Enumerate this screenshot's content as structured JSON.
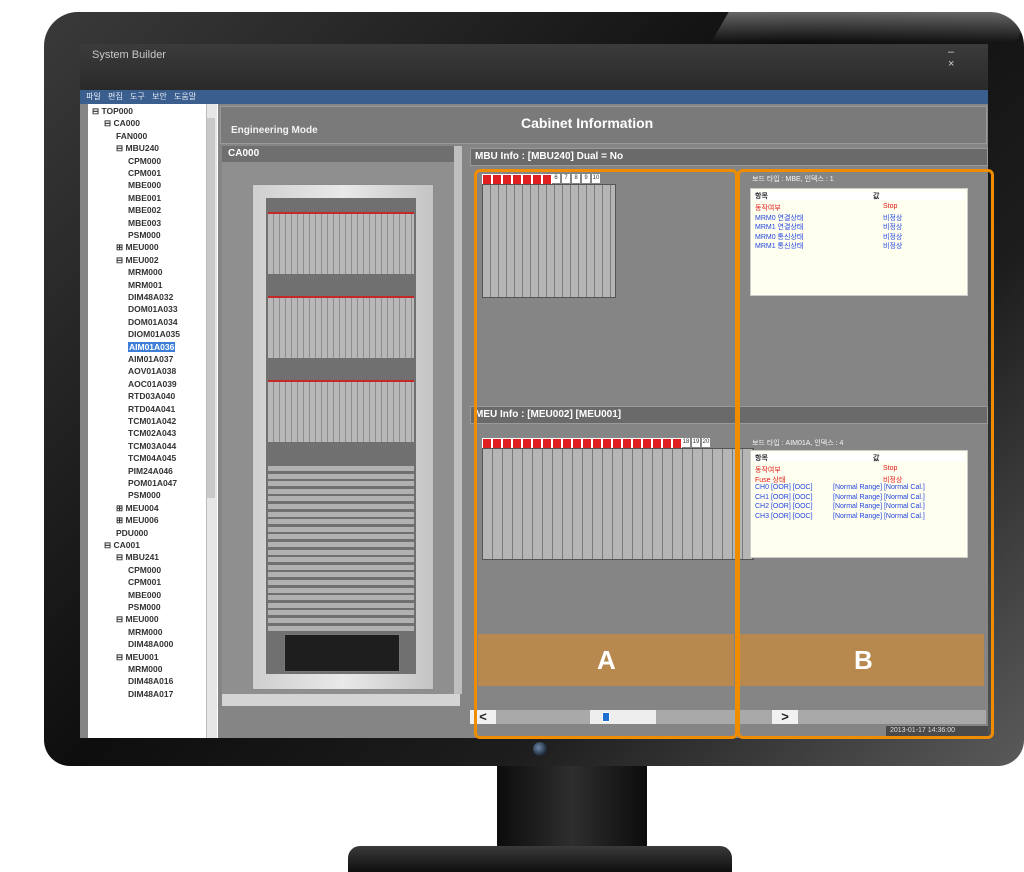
{
  "window": {
    "title": "System Builder",
    "buttons": "– ×"
  },
  "menu": [
    "파일",
    "편집",
    "도구",
    "보안",
    "도움말"
  ],
  "tree": [
    {
      "label": "⊟ TOP000",
      "indent": 0
    },
    {
      "label": "⊟ CA000",
      "indent": 1
    },
    {
      "label": "FAN000",
      "indent": 2
    },
    {
      "label": "⊟ MBU240",
      "indent": 2
    },
    {
      "label": "CPM000",
      "indent": 3
    },
    {
      "label": "CPM001",
      "indent": 3
    },
    {
      "label": "MBE000",
      "indent": 3
    },
    {
      "label": "MBE001",
      "indent": 3
    },
    {
      "label": "MBE002",
      "indent": 3
    },
    {
      "label": "MBE003",
      "indent": 3
    },
    {
      "label": "PSM000",
      "indent": 3
    },
    {
      "label": "⊞ MEU000",
      "indent": 2
    },
    {
      "label": "⊟ MEU002",
      "indent": 2
    },
    {
      "label": "MRM000",
      "indent": 3
    },
    {
      "label": "MRM001",
      "indent": 3
    },
    {
      "label": "DIM48A032",
      "indent": 3
    },
    {
      "label": "DOM01A033",
      "indent": 3
    },
    {
      "label": "DOM01A034",
      "indent": 3
    },
    {
      "label": "DIOM01A035",
      "indent": 3
    },
    {
      "label": "AIM01A036",
      "indent": 3,
      "selected": true
    },
    {
      "label": "AIM01A037",
      "indent": 3
    },
    {
      "label": "AOV01A038",
      "indent": 3
    },
    {
      "label": "AOC01A039",
      "indent": 3
    },
    {
      "label": "RTD03A040",
      "indent": 3
    },
    {
      "label": "RTD04A041",
      "indent": 3
    },
    {
      "label": "TCM01A042",
      "indent": 3
    },
    {
      "label": "TCM02A043",
      "indent": 3
    },
    {
      "label": "TCM03A044",
      "indent": 3
    },
    {
      "label": "TCM04A045",
      "indent": 3
    },
    {
      "label": "PIM24A046",
      "indent": 3
    },
    {
      "label": "POM01A047",
      "indent": 3
    },
    {
      "label": "PSM000",
      "indent": 3
    },
    {
      "label": "⊞ MEU004",
      "indent": 2
    },
    {
      "label": "⊞ MEU006",
      "indent": 2
    },
    {
      "label": "PDU000",
      "indent": 2
    },
    {
      "label": "⊟ CA001",
      "indent": 1
    },
    {
      "label": "⊟ MBU241",
      "indent": 2
    },
    {
      "label": "CPM000",
      "indent": 3
    },
    {
      "label": "CPM001",
      "indent": 3
    },
    {
      "label": "MBE000",
      "indent": 3
    },
    {
      "label": "PSM000",
      "indent": 3
    },
    {
      "label": "⊟ MEU000",
      "indent": 2
    },
    {
      "label": "MRM000",
      "indent": 3
    },
    {
      "label": "DIM48A000",
      "indent": 3
    },
    {
      "label": "⊟ MEU001",
      "indent": 2
    },
    {
      "label": "MRM000",
      "indent": 3
    },
    {
      "label": "DIM48A016",
      "indent": 3
    },
    {
      "label": "DIM48A017",
      "indent": 3
    }
  ],
  "header": {
    "mode": "Engineering Mode",
    "title": "Cabinet Information"
  },
  "cabinet": {
    "name": "CA000"
  },
  "mbu": {
    "info": "MBU Info :  [MBU240]     Dual = No",
    "led_numbers": [
      "6",
      "7",
      "8",
      "9",
      "10"
    ],
    "board_label": "보드 타입 : MBE, 인덱스 : 1",
    "table": {
      "headers": [
        "항목",
        "값"
      ],
      "rows": [
        {
          "item": "동작여부",
          "value": "Stop",
          "color": "red"
        },
        {
          "item": "MRM0 연결상태",
          "value": "비정상",
          "color": "blue"
        },
        {
          "item": "MRM1 연결상태",
          "value": "비정상",
          "color": "blue"
        },
        {
          "item": "MRM0 통신상태",
          "value": "비정상",
          "color": "blue"
        },
        {
          "item": "MRM1 통신상태",
          "value": "비정상",
          "color": "blue"
        }
      ]
    }
  },
  "meu": {
    "info": "MEU Info :  [MEU002]    [MEU001]",
    "led_numbers": [
      "18",
      "19",
      "20"
    ],
    "board_label": "보드 타입 : AIM01A, 인덱스 : 4",
    "table": {
      "headers": [
        "항목",
        "값"
      ],
      "rows": [
        {
          "item": "동작여부",
          "value": "Stop",
          "color": "red"
        },
        {
          "item": "Fuse 상태",
          "value": "비정상",
          "color": "red"
        },
        {
          "item": "CH0 [OOR] [OOC]",
          "value": "[Normal Range] [Normal Cal.]",
          "color": "blue"
        },
        {
          "item": "CH1 [OOR] [OOC]",
          "value": "[Normal Range] [Normal Cal.]",
          "color": "blue"
        },
        {
          "item": "CH2 [OOR] [OOC]",
          "value": "[Normal Range] [Normal Cal.]",
          "color": "blue"
        },
        {
          "item": "CH3 [OOR] [OOC]",
          "value": "[Normal Range] [Normal Cal.]",
          "color": "blue"
        }
      ]
    }
  },
  "overlay": {
    "a": "A",
    "b": "B",
    "frame_color": "#f08c00",
    "band_color": "#b8894e"
  },
  "nav": {
    "prev": "<",
    "next": ">"
  },
  "status": {
    "datetime": "2013-01-17 14:36:00"
  },
  "colors": {
    "selection": "#3d7fd8",
    "menubar": "#3a5f8f",
    "led": "#e02020"
  }
}
